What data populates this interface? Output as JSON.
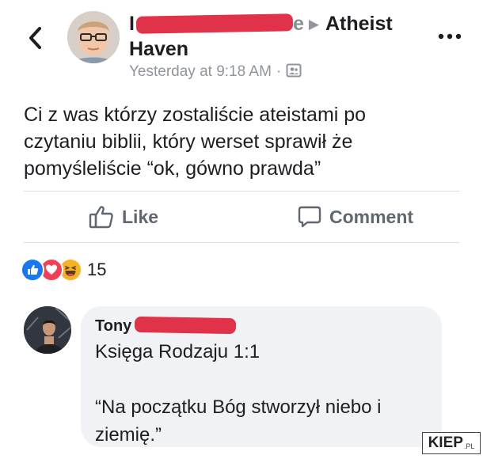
{
  "post": {
    "author_redacted_suffix": "e",
    "author_first_letter": "I",
    "group_name_line1": "Atheist",
    "group_name_line2": "Haven",
    "timestamp": "Yesterday at 9:18 AM",
    "separator": "·",
    "audience_icon": "group-audience-icon",
    "text_lines": [
      "Ci z was którzy zostaliście ateistami po",
      "czytaniu biblii, który werset sprawił że",
      "pomyśleliście “ok, gówno prawda”"
    ]
  },
  "actions": {
    "like_label": "Like",
    "comment_label": "Comment"
  },
  "reactions": {
    "icons": [
      "like-reaction-icon",
      "love-reaction-icon",
      "haha-reaction-icon"
    ],
    "count": "15"
  },
  "comment": {
    "author_visible": "Tony",
    "text_lines": [
      "Księga Rodzaju 1:1",
      "",
      "“Na początku Bóg stworzył niebo i",
      "ziemię.”"
    ]
  },
  "watermark": {
    "main": "KIEP",
    "suffix": ".PL"
  },
  "colors": {
    "redaction": "#e0334a",
    "meta_gray": "#90949c",
    "action_gray": "#606770",
    "like_blue": "#1877f2",
    "love_red": "#f33e58",
    "haha_yellow": "#f7b125",
    "bubble_bg": "#f0f2f5"
  }
}
